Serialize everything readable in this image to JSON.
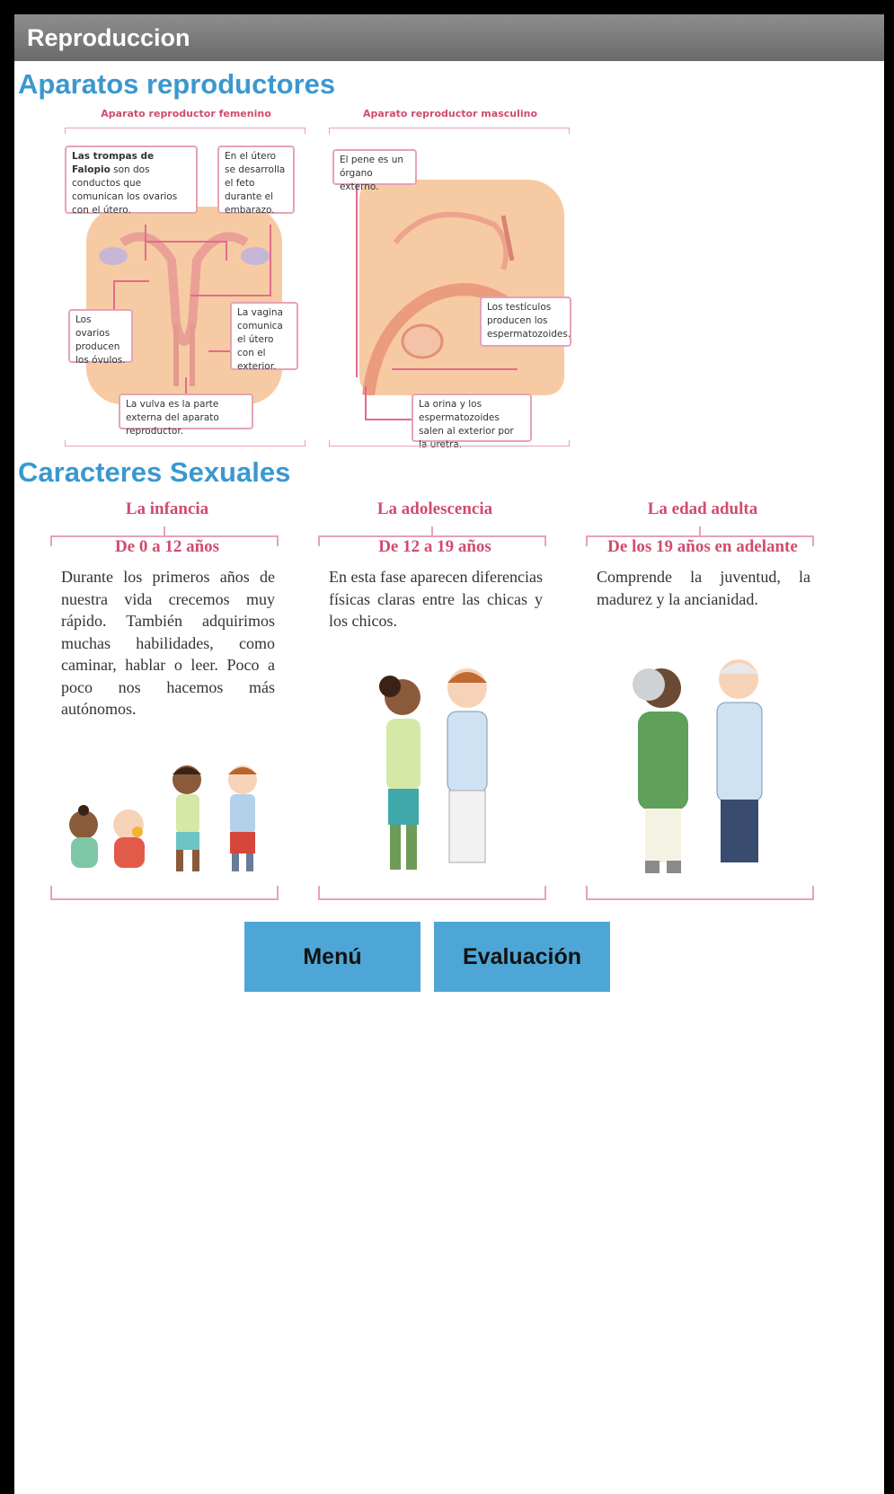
{
  "app": {
    "title": "Reproduccion"
  },
  "section1": {
    "heading": "Aparatos reproductores",
    "female": {
      "title": "Aparato reproductor femenino",
      "callouts": [
        {
          "bold": "Las trompas de Falopio",
          "text": " son dos conductos que comunican los ovarios con el útero."
        },
        {
          "bold": "",
          "text": "En el útero se desarrolla el feto durante el embarazo."
        },
        {
          "bold": "",
          "text": "Los ovarios producen los óvulos."
        },
        {
          "bold": "vagina",
          "text": "La vagina comunica el útero con el exterior."
        },
        {
          "bold": "",
          "text": "La vulva es la parte externa del aparato reproductor."
        }
      ]
    },
    "male": {
      "title": "Aparato reproductor masculino",
      "callouts": [
        {
          "text": "El pene es un órgano externo."
        },
        {
          "text": "Los testículos producen los espermatozoides."
        },
        {
          "text": "La orina y los espermatozoides salen al exterior por la uretra."
        }
      ]
    }
  },
  "section2": {
    "heading": "Caracteres Sexuales",
    "stages": [
      {
        "title": "La infancia",
        "age": "De 0 a 12 años",
        "text": "Durante los primeros años de nuestra vida crecemos muy rápido. También adquirimos muchas habilidades, como caminar, hablar o leer. Poco a poco nos hacemos más autónomos."
      },
      {
        "title": "La adolescencia",
        "age": "De 12 a 19 años",
        "text": "En esta fase aparecen diferencias físicas claras entre las chicas y los chicos."
      },
      {
        "title": "La edad adulta",
        "age": "De los 19 años en adelante",
        "text": "Comprende la juventud, la madurez y la ancianidad."
      }
    ]
  },
  "buttons": {
    "menu": "Menú",
    "evaluation": "Evaluación"
  },
  "colors": {
    "accent": "#3a98cf",
    "button": "#4ea6d6",
    "pink": "#d14b6e",
    "titlebar": "#7b7b7b"
  }
}
